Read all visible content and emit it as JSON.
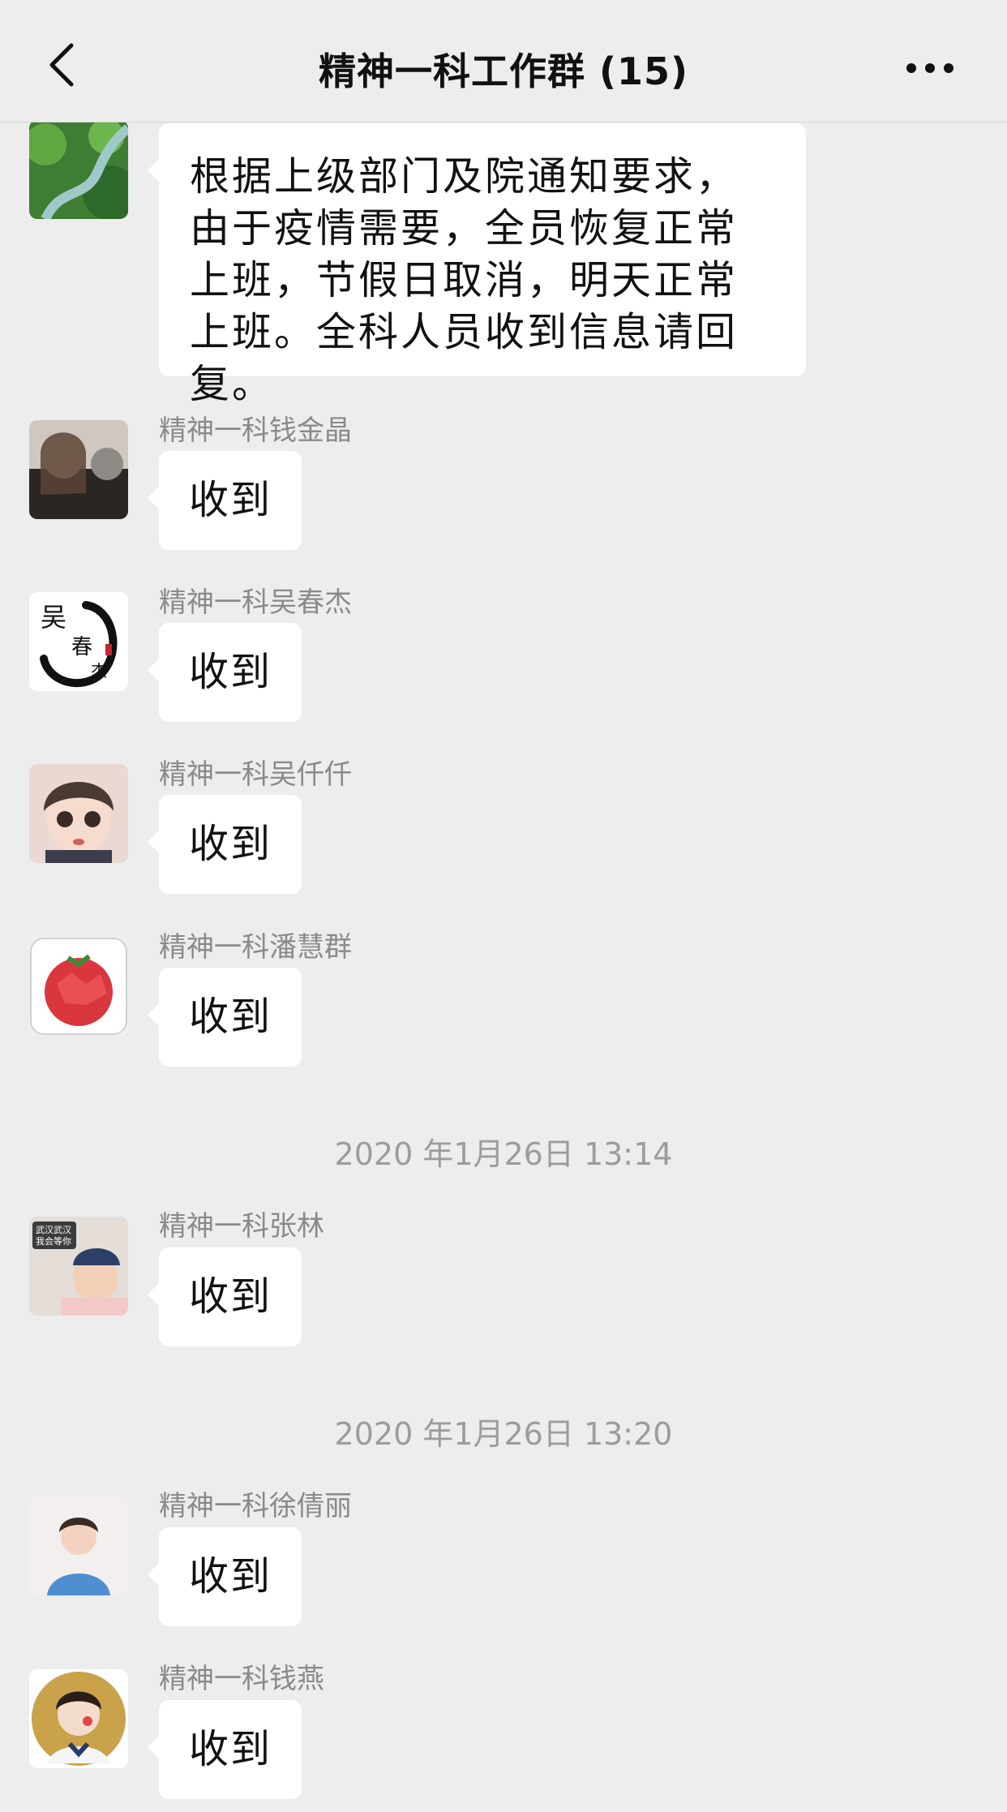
{
  "header": {
    "title": "精神一科工作群 (15)"
  },
  "announcement": {
    "text": "根据上级部门及院通知要求，由于疫情需要，全员恢复正常上班，节假日取消，明天正常上班。全科人员收到信息请回复。"
  },
  "messages": [
    {
      "sender": "精神一科钱金晶",
      "text": "收到"
    },
    {
      "sender": "精神一科吴春杰",
      "text": "收到"
    },
    {
      "sender": "精神一科吴仟仟",
      "text": "收到"
    },
    {
      "sender": "精神一科潘慧群",
      "text": "收到"
    },
    {
      "sender": "精神一科张林",
      "text": "收到"
    },
    {
      "sender": "精神一科徐倩丽",
      "text": "收到"
    },
    {
      "sender": "精神一科钱燕",
      "text": "收到"
    }
  ],
  "timestamps": [
    "2020 年1月26日 13:14",
    "2020 年1月26日 13:20"
  ],
  "avatar_badge": {
    "line1": "武汉武汉",
    "line2": "我会等你"
  },
  "icons": [
    "back-chevron-icon",
    "more-dots-icon"
  ],
  "colors": {
    "background": "#ededed",
    "bubble": "#ffffff",
    "meta_text": "#8a8a8a",
    "timestamp_text": "#9c9c9c"
  }
}
